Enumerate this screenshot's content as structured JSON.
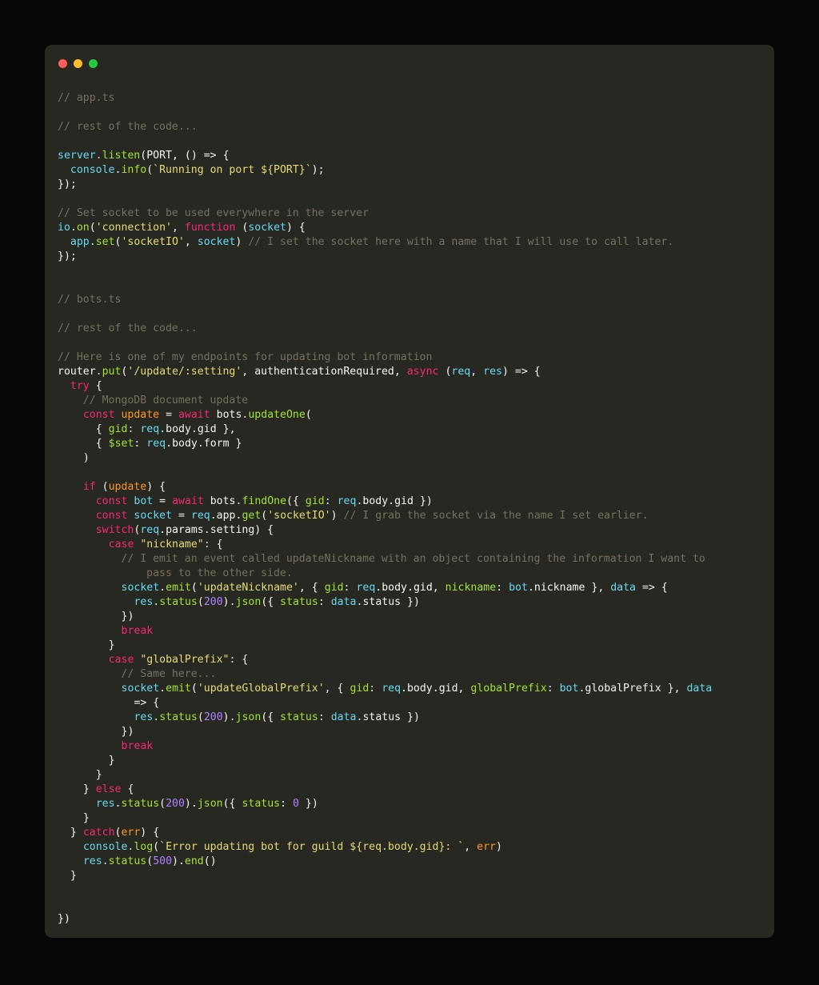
{
  "window": {
    "traffic_lights": [
      {
        "name": "close",
        "color": "#FF5F56"
      },
      {
        "name": "minimize",
        "color": "#FFBD2E"
      },
      {
        "name": "maximize",
        "color": "#27C93F"
      }
    ],
    "background": "#060606",
    "card_background": "#272822"
  },
  "theme": {
    "name": "monokai",
    "comment": "#75715E",
    "keyword": "#F92672",
    "function": "#A6E22E",
    "string": "#E6DB74",
    "number": "#AE81FF",
    "variable": "#66D9EF",
    "parameter": "#FD971F",
    "plain": "#F8F8F2"
  },
  "code": {
    "language": "typescript",
    "files": [
      "app.ts",
      "bots.ts"
    ],
    "lines": [
      "// app.ts",
      "",
      "// rest of the code...",
      "",
      "server.listen(PORT, () => {",
      "  console.info(`Running on port ${PORT}`);",
      "});",
      "",
      "// Set socket to be used everywhere in the server",
      "io.on('connection', function (socket) {",
      "  app.set('socketIO', socket) // I set the socket here with a name that I will use to call later.",
      "});",
      "",
      "",
      "// bots.ts",
      "",
      "// rest of the code...",
      "",
      "// Here is one of my endpoints for updating bot information",
      "router.put('/update/:setting', authenticationRequired, async (req, res) => {",
      "  try {",
      "    // MongoDB document update",
      "    const update = await bots.updateOne(",
      "      { gid: req.body.gid },",
      "      { $set: req.body.form }",
      "    )",
      "",
      "    if (update) {",
      "      const bot = await bots.findOne({ gid: req.body.gid })",
      "      const socket = req.app.get('socketIO') // I grab the socket via the name I set earlier.",
      "      switch(req.params.setting) {",
      "        case \"nickname\": {",
      "          // I emit an event called updateNickname with an object containing the information I want to",
      "              pass to the other side.",
      "          socket.emit('updateNickname', { gid: req.body.gid, nickname: bot.nickname }, data => {",
      "            res.status(200).json({ status: data.status })",
      "          })",
      "          break",
      "        }",
      "        case \"globalPrefix\": {",
      "          // Same here...",
      "          socket.emit('updateGlobalPrefix', { gid: req.body.gid, globalPrefix: bot.globalPrefix }, data",
      "            => {",
      "            res.status(200).json({ status: data.status })",
      "          })",
      "          break",
      "        }",
      "      }",
      "    } else {",
      "      res.status(200).json({ status: 0 })",
      "    }",
      "  } catch(err) {",
      "    console.log(`Error updating bot for guild ${req.body.gid}: `, err)",
      "    res.status(500).end()",
      "  }",
      "",
      "",
      "})"
    ]
  }
}
